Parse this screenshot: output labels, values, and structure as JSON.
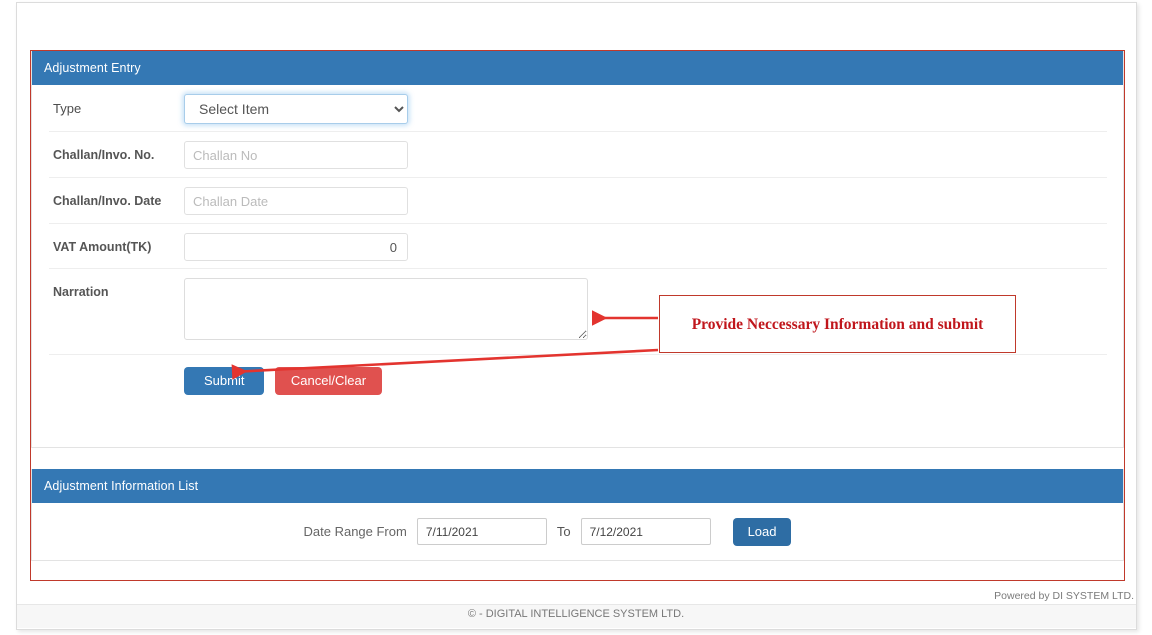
{
  "entry_panel": {
    "title": "Adjustment Entry",
    "fields": {
      "type": {
        "label": "Type",
        "selected": "Select Item"
      },
      "challan_no": {
        "label": "Challan/Invo. No.",
        "placeholder": "Challan No",
        "value": ""
      },
      "challan_date": {
        "label": "Challan/Invo. Date",
        "placeholder": "Challan Date",
        "value": ""
      },
      "vat_amount": {
        "label": "VAT Amount(TK)",
        "value": "0",
        "placeholder": ""
      },
      "narration": {
        "label": "Narration",
        "value": "",
        "placeholder": ""
      }
    },
    "buttons": {
      "submit": "Submit",
      "cancel": "Cancel/Clear"
    }
  },
  "list_panel": {
    "title": "Adjustment Information List",
    "date_range_label": "Date Range From",
    "date_from": "7/11/2021",
    "to_label": "To",
    "date_to": "7/12/2021",
    "load_button": "Load"
  },
  "annotation": {
    "text": "Provide Neccessary Information and submit",
    "color": "#c0161c",
    "border_color": "#c0392b"
  },
  "footer": {
    "powered_by": "Powered by DI SYSTEM LTD.",
    "copyright": "©  - DIGITAL INTELLIGENCE SYSTEM LTD."
  },
  "theme": {
    "panel_header_bg": "#3478b4",
    "submit_bg": "#3478b4",
    "cancel_bg": "#e0514f",
    "load_bg": "#2e6da4"
  }
}
